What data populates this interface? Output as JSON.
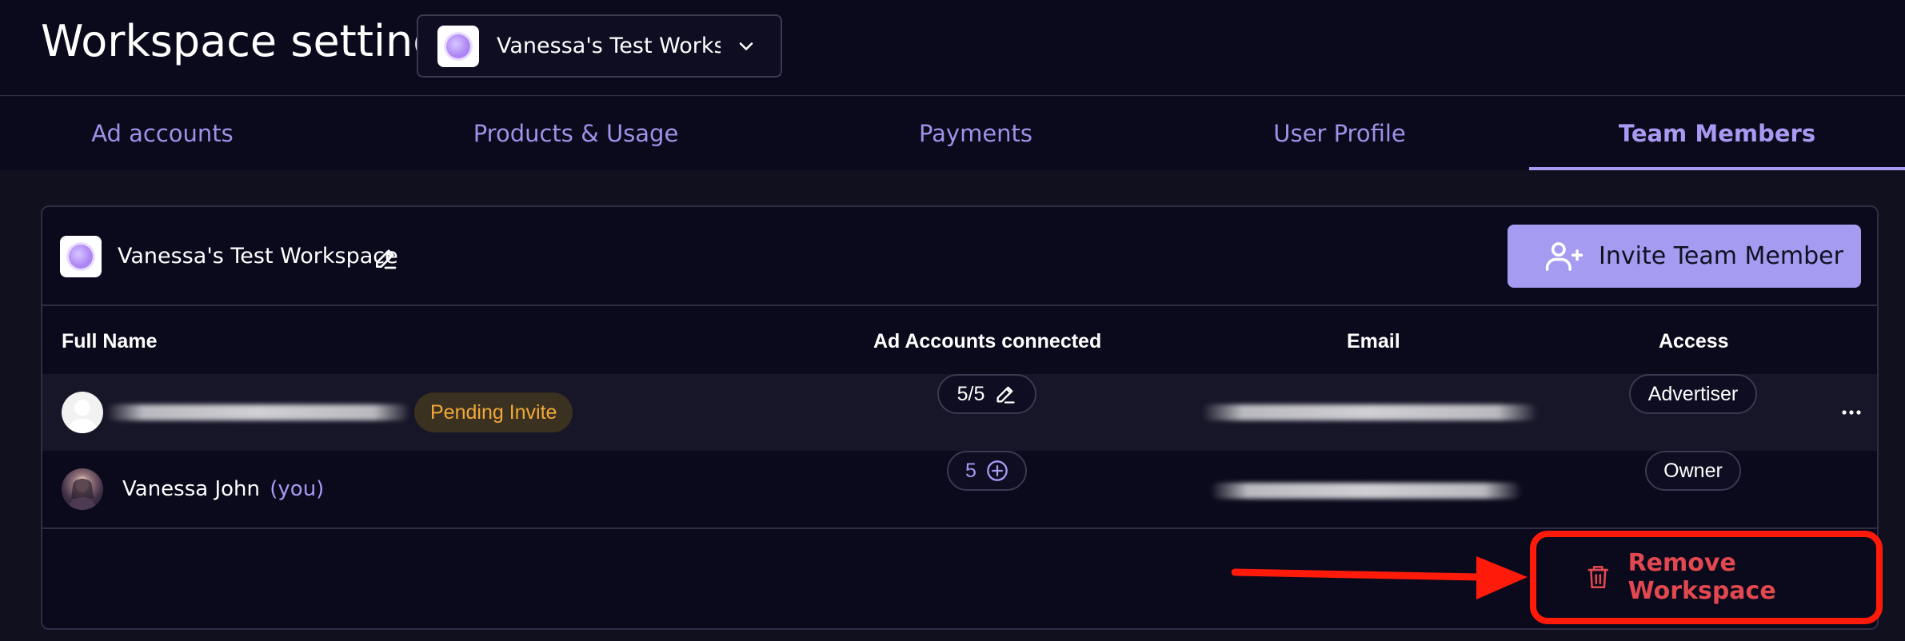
{
  "header": {
    "title": "Workspace settings",
    "workspace_select": {
      "label": "Vanessa's Test Worksp..."
    }
  },
  "tabs": [
    {
      "label": "Ad accounts",
      "active": false
    },
    {
      "label": "Products & Usage",
      "active": false
    },
    {
      "label": "Payments",
      "active": false
    },
    {
      "label": "User Profile",
      "active": false
    },
    {
      "label": "Team Members",
      "active": true
    }
  ],
  "card": {
    "workspace_name": "Vanessa's Test Workspace",
    "invite_label": "Invite Team Member",
    "table": {
      "headers": [
        "Full Name",
        "Ad Accounts connected",
        "Email",
        "Access"
      ],
      "rows": [
        {
          "name": "",
          "status_badge": "Pending Invite",
          "ad_accounts": "5/5",
          "ad_accounts_icon": "pencil-icon",
          "access": "Advertiser",
          "avatar": "blank-avatar"
        },
        {
          "name": "Vanessa John",
          "you_tag": "(you)",
          "ad_accounts": "5",
          "ad_accounts_icon": "plus-circle-icon",
          "access": "Owner",
          "avatar": "photo-avatar"
        }
      ]
    },
    "remove_label": "Remove Workspace"
  },
  "colors": {
    "background": "#10101f",
    "panel": "#0b0a1c",
    "accent": "#a899f2",
    "invite_button": "#a59cf1",
    "danger": "#e2484f",
    "pending": "#f3a93a",
    "annotation": "#ff1a0a"
  }
}
